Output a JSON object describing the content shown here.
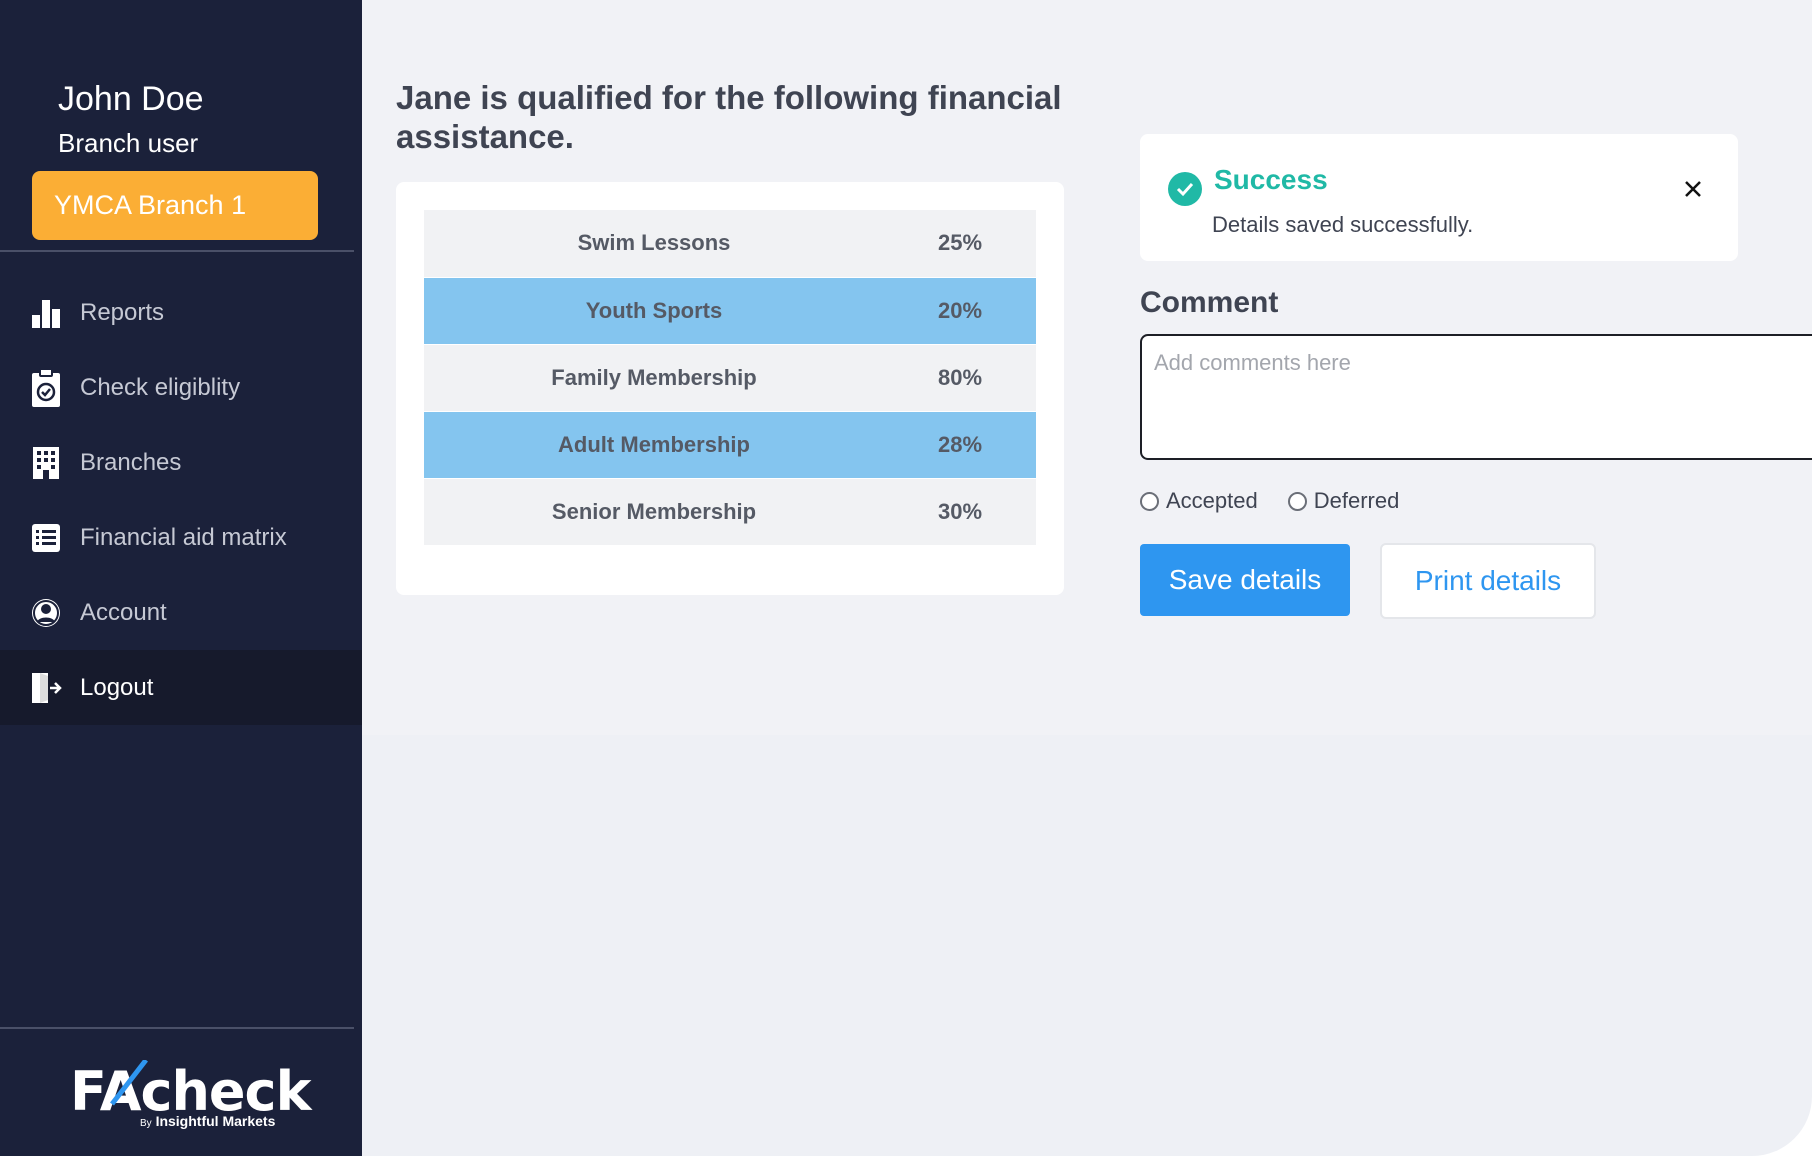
{
  "sidebar": {
    "user_name": "John Doe",
    "user_role": "Branch user",
    "branch_label": "YMCA Branch 1",
    "items": [
      {
        "label": "Reports",
        "icon": "bar-chart-icon"
      },
      {
        "label": "Check eligiblity",
        "icon": "clipboard-check-icon"
      },
      {
        "label": "Branches",
        "icon": "building-icon"
      },
      {
        "label": "Financial aid matrix",
        "icon": "list-icon"
      },
      {
        "label": "Account",
        "icon": "user-circle-icon"
      },
      {
        "label": "Logout",
        "icon": "logout-icon",
        "active": true
      }
    ],
    "logo": {
      "text": "FAcheck",
      "by": "By",
      "company": "Insightful Markets"
    }
  },
  "main": {
    "heading": "Jane is qualified for the following financial assistance.",
    "aid_table": [
      {
        "program": "Swim Lessons",
        "percent": "25%"
      },
      {
        "program": "Youth Sports",
        "percent": "20%"
      },
      {
        "program": "Family Membership",
        "percent": "80%"
      },
      {
        "program": "Adult Membership",
        "percent": "28%"
      },
      {
        "program": "Senior Membership",
        "percent": "30%"
      }
    ],
    "alert": {
      "title": "Success",
      "message": "Details saved successfully."
    },
    "comment": {
      "label": "Comment",
      "placeholder": "Add comments here",
      "value": ""
    },
    "radios": [
      {
        "label": "Accepted",
        "checked": false
      },
      {
        "label": "Deferred",
        "checked": false
      }
    ],
    "save_label": "Save details",
    "print_label": "Print details"
  },
  "colors": {
    "sidebar_bg": "#1b213a",
    "branch_accent": "#fbae35",
    "primary": "#2e96f0",
    "success": "#20b9a6",
    "row_highlight": "#84c5ef"
  }
}
